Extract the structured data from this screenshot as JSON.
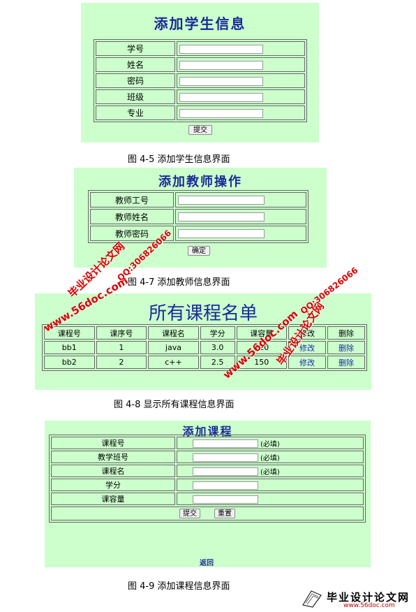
{
  "figure5": {
    "title": "添加学生信息",
    "fields": [
      "学号",
      "姓名",
      "密码",
      "班级",
      "专业"
    ],
    "submit": "提交",
    "caption": "图 4-5 添加学生信息界面"
  },
  "figure7": {
    "title": "添加教师操作",
    "fields": [
      "教师工号",
      "教师姓名",
      "教师密码"
    ],
    "confirm": "确定",
    "caption": "图 4-7 添加教师信息界面"
  },
  "figure8": {
    "title": "所有课程名单",
    "headers": [
      "课程号",
      "课序号",
      "课程名",
      "学分",
      "课容量",
      "修改",
      "删除"
    ],
    "rows": [
      [
        "bb1",
        "1",
        "java",
        "3.0",
        "120",
        "修改",
        "删除"
      ],
      [
        "bb2",
        "2",
        "c++",
        "2.5",
        "150",
        "修改",
        "删除"
      ]
    ],
    "caption": "图 4-8 显示所有课程信息界面"
  },
  "figure9": {
    "title": "添加课程",
    "fields": [
      {
        "label": "课程号",
        "note": "(必填)"
      },
      {
        "label": "教学班号",
        "note": "(必填)"
      },
      {
        "label": "课程名",
        "note": "(必填)"
      },
      {
        "label": "学分",
        "note": ""
      },
      {
        "label": "课容量",
        "note": ""
      }
    ],
    "submit": "提交",
    "reset": "重置",
    "back": "返回",
    "caption": "图 4-9 添加课程信息界面"
  },
  "watermarks": {
    "site": "www.56doc.com",
    "name": "毕业设计论文网",
    "qq": "QQ:306826066"
  },
  "footer_logo": {
    "name": "毕业设计论文网",
    "url": "www.56doc.com"
  },
  "colors": {
    "panel": "#ccffcc",
    "title": "#1a2a9a",
    "watermark": "#dd0000"
  }
}
